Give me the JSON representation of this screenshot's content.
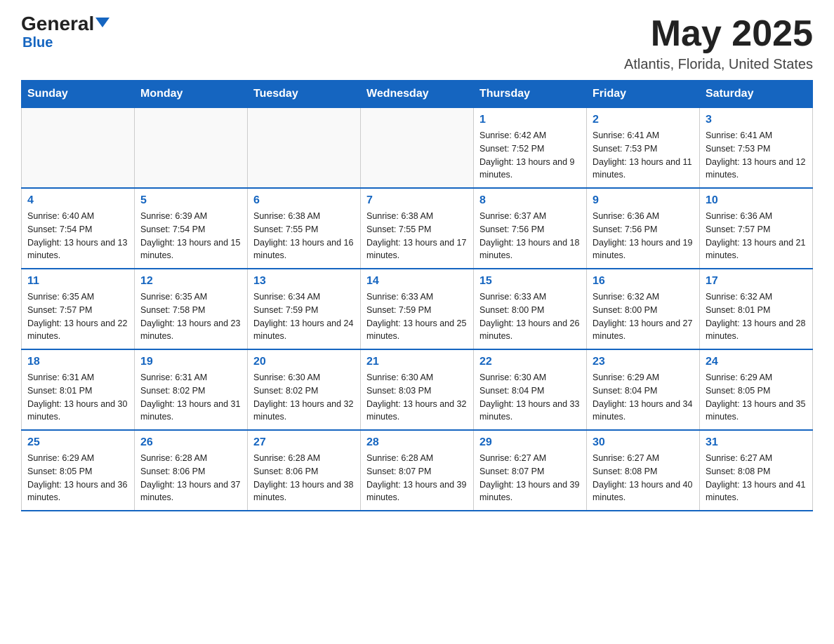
{
  "header": {
    "logo_general": "General",
    "logo_blue": "Blue",
    "month_title": "May 2025",
    "location": "Atlantis, Florida, United States"
  },
  "weekdays": [
    "Sunday",
    "Monday",
    "Tuesday",
    "Wednesday",
    "Thursday",
    "Friday",
    "Saturday"
  ],
  "weeks": [
    [
      {
        "day": "",
        "info": ""
      },
      {
        "day": "",
        "info": ""
      },
      {
        "day": "",
        "info": ""
      },
      {
        "day": "",
        "info": ""
      },
      {
        "day": "1",
        "info": "Sunrise: 6:42 AM\nSunset: 7:52 PM\nDaylight: 13 hours and 9 minutes."
      },
      {
        "day": "2",
        "info": "Sunrise: 6:41 AM\nSunset: 7:53 PM\nDaylight: 13 hours and 11 minutes."
      },
      {
        "day": "3",
        "info": "Sunrise: 6:41 AM\nSunset: 7:53 PM\nDaylight: 13 hours and 12 minutes."
      }
    ],
    [
      {
        "day": "4",
        "info": "Sunrise: 6:40 AM\nSunset: 7:54 PM\nDaylight: 13 hours and 13 minutes."
      },
      {
        "day": "5",
        "info": "Sunrise: 6:39 AM\nSunset: 7:54 PM\nDaylight: 13 hours and 15 minutes."
      },
      {
        "day": "6",
        "info": "Sunrise: 6:38 AM\nSunset: 7:55 PM\nDaylight: 13 hours and 16 minutes."
      },
      {
        "day": "7",
        "info": "Sunrise: 6:38 AM\nSunset: 7:55 PM\nDaylight: 13 hours and 17 minutes."
      },
      {
        "day": "8",
        "info": "Sunrise: 6:37 AM\nSunset: 7:56 PM\nDaylight: 13 hours and 18 minutes."
      },
      {
        "day": "9",
        "info": "Sunrise: 6:36 AM\nSunset: 7:56 PM\nDaylight: 13 hours and 19 minutes."
      },
      {
        "day": "10",
        "info": "Sunrise: 6:36 AM\nSunset: 7:57 PM\nDaylight: 13 hours and 21 minutes."
      }
    ],
    [
      {
        "day": "11",
        "info": "Sunrise: 6:35 AM\nSunset: 7:57 PM\nDaylight: 13 hours and 22 minutes."
      },
      {
        "day": "12",
        "info": "Sunrise: 6:35 AM\nSunset: 7:58 PM\nDaylight: 13 hours and 23 minutes."
      },
      {
        "day": "13",
        "info": "Sunrise: 6:34 AM\nSunset: 7:59 PM\nDaylight: 13 hours and 24 minutes."
      },
      {
        "day": "14",
        "info": "Sunrise: 6:33 AM\nSunset: 7:59 PM\nDaylight: 13 hours and 25 minutes."
      },
      {
        "day": "15",
        "info": "Sunrise: 6:33 AM\nSunset: 8:00 PM\nDaylight: 13 hours and 26 minutes."
      },
      {
        "day": "16",
        "info": "Sunrise: 6:32 AM\nSunset: 8:00 PM\nDaylight: 13 hours and 27 minutes."
      },
      {
        "day": "17",
        "info": "Sunrise: 6:32 AM\nSunset: 8:01 PM\nDaylight: 13 hours and 28 minutes."
      }
    ],
    [
      {
        "day": "18",
        "info": "Sunrise: 6:31 AM\nSunset: 8:01 PM\nDaylight: 13 hours and 30 minutes."
      },
      {
        "day": "19",
        "info": "Sunrise: 6:31 AM\nSunset: 8:02 PM\nDaylight: 13 hours and 31 minutes."
      },
      {
        "day": "20",
        "info": "Sunrise: 6:30 AM\nSunset: 8:02 PM\nDaylight: 13 hours and 32 minutes."
      },
      {
        "day": "21",
        "info": "Sunrise: 6:30 AM\nSunset: 8:03 PM\nDaylight: 13 hours and 32 minutes."
      },
      {
        "day": "22",
        "info": "Sunrise: 6:30 AM\nSunset: 8:04 PM\nDaylight: 13 hours and 33 minutes."
      },
      {
        "day": "23",
        "info": "Sunrise: 6:29 AM\nSunset: 8:04 PM\nDaylight: 13 hours and 34 minutes."
      },
      {
        "day": "24",
        "info": "Sunrise: 6:29 AM\nSunset: 8:05 PM\nDaylight: 13 hours and 35 minutes."
      }
    ],
    [
      {
        "day": "25",
        "info": "Sunrise: 6:29 AM\nSunset: 8:05 PM\nDaylight: 13 hours and 36 minutes."
      },
      {
        "day": "26",
        "info": "Sunrise: 6:28 AM\nSunset: 8:06 PM\nDaylight: 13 hours and 37 minutes."
      },
      {
        "day": "27",
        "info": "Sunrise: 6:28 AM\nSunset: 8:06 PM\nDaylight: 13 hours and 38 minutes."
      },
      {
        "day": "28",
        "info": "Sunrise: 6:28 AM\nSunset: 8:07 PM\nDaylight: 13 hours and 39 minutes."
      },
      {
        "day": "29",
        "info": "Sunrise: 6:27 AM\nSunset: 8:07 PM\nDaylight: 13 hours and 39 minutes."
      },
      {
        "day": "30",
        "info": "Sunrise: 6:27 AM\nSunset: 8:08 PM\nDaylight: 13 hours and 40 minutes."
      },
      {
        "day": "31",
        "info": "Sunrise: 6:27 AM\nSunset: 8:08 PM\nDaylight: 13 hours and 41 minutes."
      }
    ]
  ]
}
